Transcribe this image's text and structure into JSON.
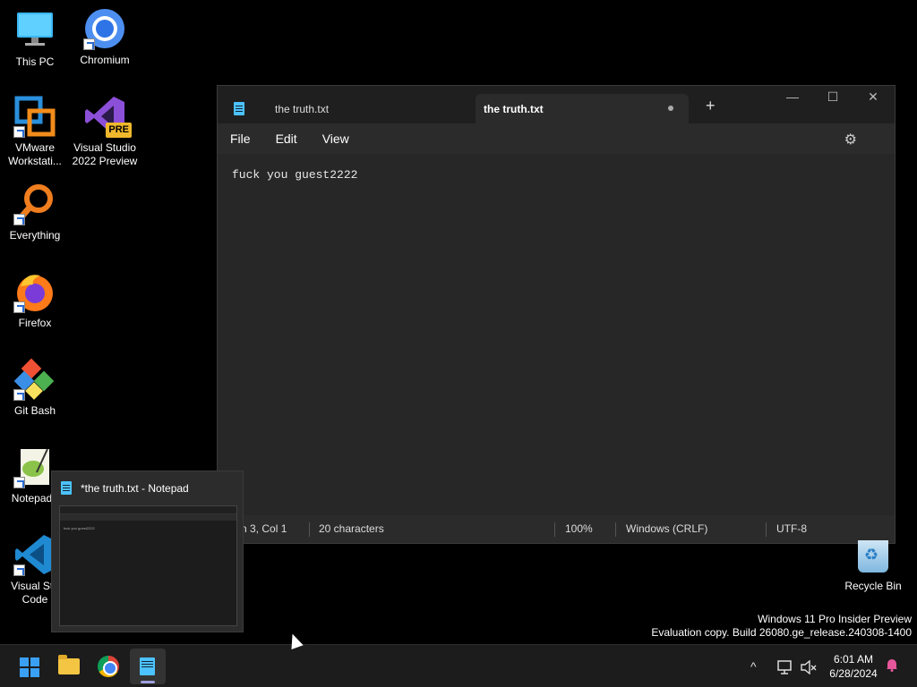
{
  "desktop": {
    "icons": [
      {
        "label": "This PC"
      },
      {
        "label": "Chromium"
      },
      {
        "label": "VMware\nWorkstati..."
      },
      {
        "label": "Visual Studio\n2022 Preview"
      },
      {
        "label": "Everything"
      },
      {
        "label": "Firefox"
      },
      {
        "label": "Git Bash"
      },
      {
        "label": "Notepad+"
      },
      {
        "label": "Visual Stu\nCode"
      }
    ],
    "recycle_bin": "Recycle Bin",
    "vs_badge": "PRE",
    "watermark_line1": "Windows 11 Pro Insider Preview",
    "watermark_line2": "Evaluation copy. Build 26080.ge_release.240308-1400"
  },
  "notepad": {
    "tabs": [
      {
        "label": "the truth.txt"
      },
      {
        "label": "the truth.txt"
      }
    ],
    "new_tab": "+",
    "minimize": "—",
    "maximize": "☐",
    "close": "✕",
    "menu": {
      "file": "File",
      "edit": "Edit",
      "view": "View"
    },
    "content": "fuck you guest2222",
    "status": {
      "position": "n 3, Col 1",
      "characters": "20 characters",
      "zoom": "100%",
      "line_ending": "Windows (CRLF)",
      "encoding": "UTF-8"
    }
  },
  "thumbnail": {
    "title": "*the truth.txt - Notepad",
    "preview_text": "fuck you guest2222"
  },
  "taskbar": {
    "time": "6:01 AM",
    "date": "6/28/2024",
    "tray_chevron": "^"
  },
  "colors": {
    "accent": "#4cc2ff",
    "taskbar": "#1c1c1c",
    "window": "#272727"
  }
}
